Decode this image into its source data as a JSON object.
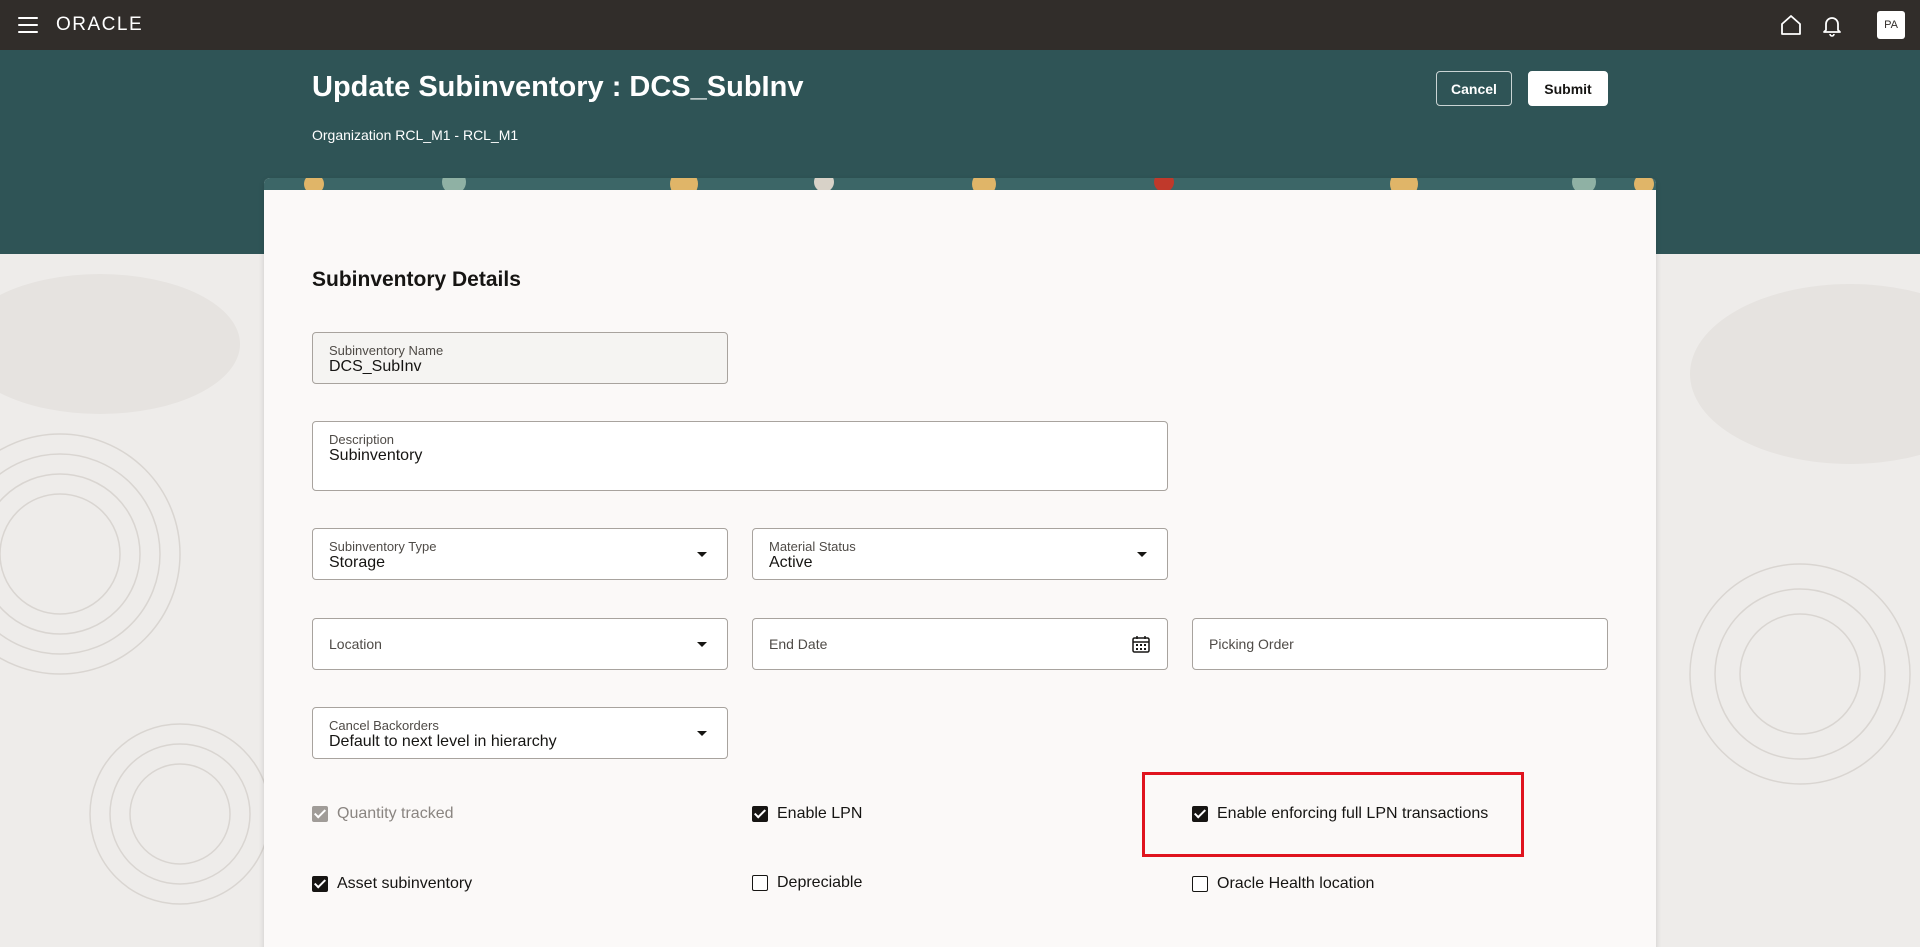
{
  "global_header": {
    "brand": "ORACLE",
    "avatar_initials": "PA",
    "icons": [
      "menu-icon",
      "home-icon",
      "notifications-icon"
    ]
  },
  "page": {
    "title": "Update Subinventory : DCS_SubInv",
    "organization_label": "Organization",
    "organization_value": "RCL_M1 - RCL_M1",
    "cancel_label": "Cancel",
    "submit_label": "Submit"
  },
  "section": {
    "title": "Subinventory Details"
  },
  "fields": {
    "subinventory_name": {
      "label": "Subinventory Name",
      "value": "DCS_SubInv"
    },
    "description": {
      "label": "Description",
      "value": "Subinventory"
    },
    "subinventory_type": {
      "label": "Subinventory Type",
      "value": "Storage"
    },
    "material_status": {
      "label": "Material Status",
      "value": "Active"
    },
    "location": {
      "placeholder": "Location"
    },
    "end_date": {
      "placeholder": "End Date"
    },
    "picking_order": {
      "placeholder": "Picking Order"
    },
    "cancel_backorders": {
      "label": "Cancel Backorders",
      "value": "Default to next level in hierarchy"
    }
  },
  "checkboxes": {
    "quantity_tracked": {
      "label": "Quantity tracked",
      "checked": true,
      "disabled": true
    },
    "enable_lpn": {
      "label": "Enable LPN",
      "checked": true
    },
    "enable_full_lpn": {
      "label": "Enable enforcing full LPN transactions",
      "checked": true
    },
    "asset_subinventory": {
      "label": "Asset subinventory",
      "checked": true
    },
    "depreciable": {
      "label": "Depreciable",
      "checked": false
    },
    "oracle_health_location": {
      "label": "Oracle Health location",
      "checked": false
    }
  },
  "colors": {
    "header_band": "#2f5456",
    "top_bar": "#312d2a",
    "highlight_box": "#e0141e"
  }
}
